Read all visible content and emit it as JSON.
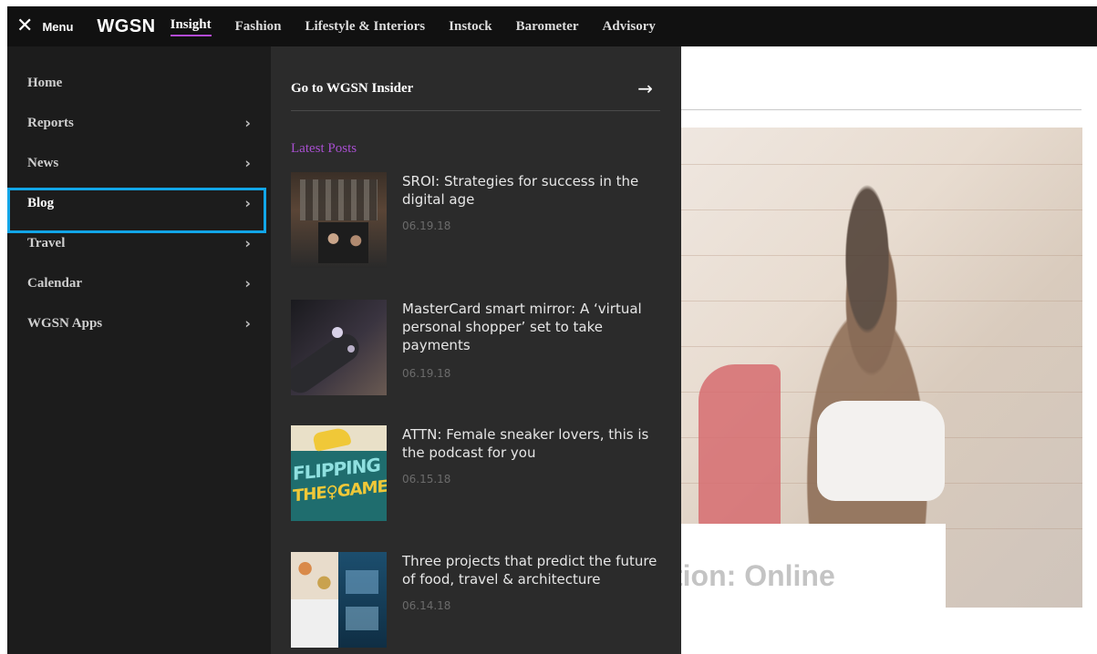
{
  "topbar": {
    "menu_label": "Menu",
    "logo": "WGSN",
    "nav": [
      "Insight",
      "Fashion",
      "Lifestyle & Interiors",
      "Instock",
      "Barometer",
      "Advisory"
    ],
    "active_nav": "Insight"
  },
  "left_menu": {
    "items": [
      {
        "label": "Home",
        "has_submenu": false
      },
      {
        "label": "Reports",
        "has_submenu": true
      },
      {
        "label": "News",
        "has_submenu": true
      },
      {
        "label": "Blog",
        "has_submenu": true
      },
      {
        "label": "Travel",
        "has_submenu": true
      },
      {
        "label": "Calendar",
        "has_submenu": true
      },
      {
        "label": "WGSN Apps",
        "has_submenu": true
      }
    ],
    "selected": "Blog"
  },
  "flyout": {
    "insider_label": "Go to WGSN Insider",
    "latest_heading": "Latest Posts",
    "posts": [
      {
        "title": "SROI: Strategies for success in the digital age",
        "date": "06.19.18"
      },
      {
        "title": "MasterCard smart mirror: A ‘virtual personal shopper’ set to take payments",
        "date": "06.19.18"
      },
      {
        "title": "ATTN: Female sneaker lovers, this is the podcast for you",
        "date": "06.15.18"
      },
      {
        "title": "Three projects that predict the future of food, travel & architecture",
        "date": "06.14.18"
      }
    ],
    "thumb3_text": [
      "FLIPPING",
      "THE♀GAME"
    ]
  },
  "background_page": {
    "headline_fragment": "tion: Online"
  },
  "colors": {
    "accent_purple": "#a84fd0",
    "highlight_blue": "#12a6e8",
    "panel_dark": "#1c1c1c",
    "flyout_dark": "#2b2b2b"
  }
}
